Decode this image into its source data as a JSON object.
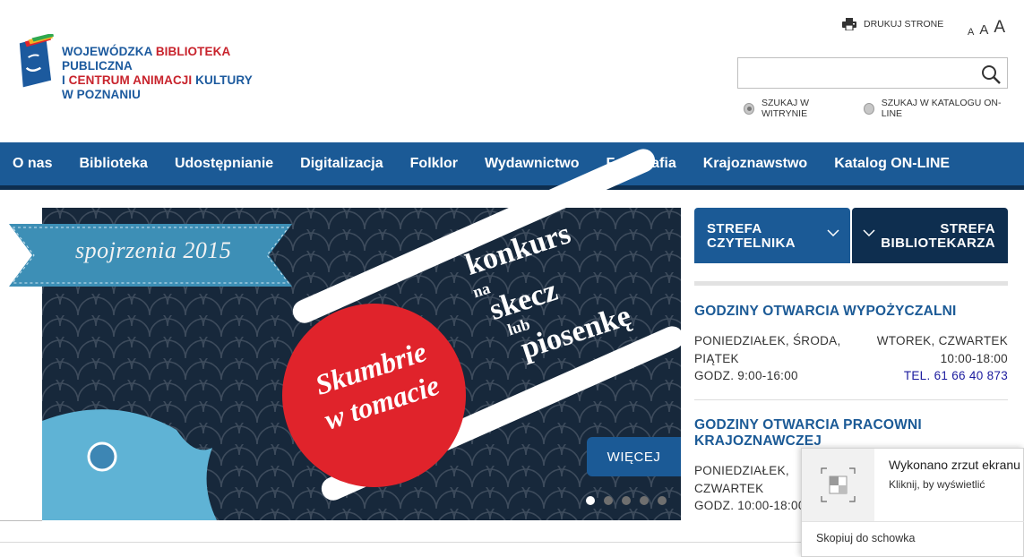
{
  "header": {
    "logo": {
      "line1_a": "WOJEWÓDZKA ",
      "line1_b": "BIBLIOTEKA",
      "line1_c": " PUBLICZNA",
      "line2_a": "I ",
      "line2_b": "CENTRUM ANIMACJI",
      "line2_c": " KULTURY",
      "line3": "W POZNANIU"
    },
    "print_label": "DRUKUJ STRONE",
    "font_sizes": [
      "A",
      "A",
      "A"
    ],
    "search": {
      "value": "",
      "placeholder": ""
    },
    "search_options": [
      "SZUKAJ W WITRYNIE",
      "SZUKAJ W KATALOGU ON-LINE"
    ]
  },
  "nav": {
    "items": [
      "O nas",
      "Biblioteka",
      "Udostępnianie",
      "Digitalizacja",
      "Folklor",
      "Wydawnictwo",
      "Fotografia",
      "Krajoznawstwo",
      "Katalog ON-LINE"
    ]
  },
  "slider": {
    "ribbon": "spojrzenia 2015",
    "circle_line1": "Skumbrie",
    "circle_line2": "w tomacie",
    "konkurs": [
      "konkurs",
      "na",
      "skecz",
      "lub",
      "piosenkę"
    ],
    "more_label": "WIĘCEJ",
    "slide_count": 5,
    "active_slide": 1
  },
  "zones": {
    "reader_line1": "STREFA",
    "reader_line2": "CZYTELNIKA",
    "librarian_line1": "STREFA",
    "librarian_line2": "BIBLIOTEKARZA"
  },
  "hours": {
    "lending": {
      "title": "GODZINY OTWARCIA WYPOŻYCZALNI",
      "left_line1": "PONIEDZIAŁEK, ŚRODA,",
      "left_line2": "PIĄTEK",
      "left_line3": "GODZ. 9:00-16:00",
      "right_line1": "WTOREK, CZWARTEK",
      "right_line2": "10:00-18:00",
      "right_line3": "TEL. 61 66 40 873"
    },
    "regional": {
      "title_line1": "GODZINY OTWARCIA PRACOWNI",
      "title_line2": "KRAJOZNAWCZEJ",
      "left_line1": "PONIEDZIAŁEK,",
      "left_line2": "CZWARTEK",
      "left_line3": "GODZ. 10:00-18:00"
    }
  },
  "toast": {
    "title": "Wykonano zrzut ekranu",
    "subtitle": "Kliknij, by wyświetlić",
    "action": "Skopiuj do schowka"
  },
  "colors": {
    "brand_blue": "#1b5a96",
    "dark_navy": "#0e2e4f",
    "logo_red": "#c8232c",
    "slide_red": "#e0232b"
  }
}
